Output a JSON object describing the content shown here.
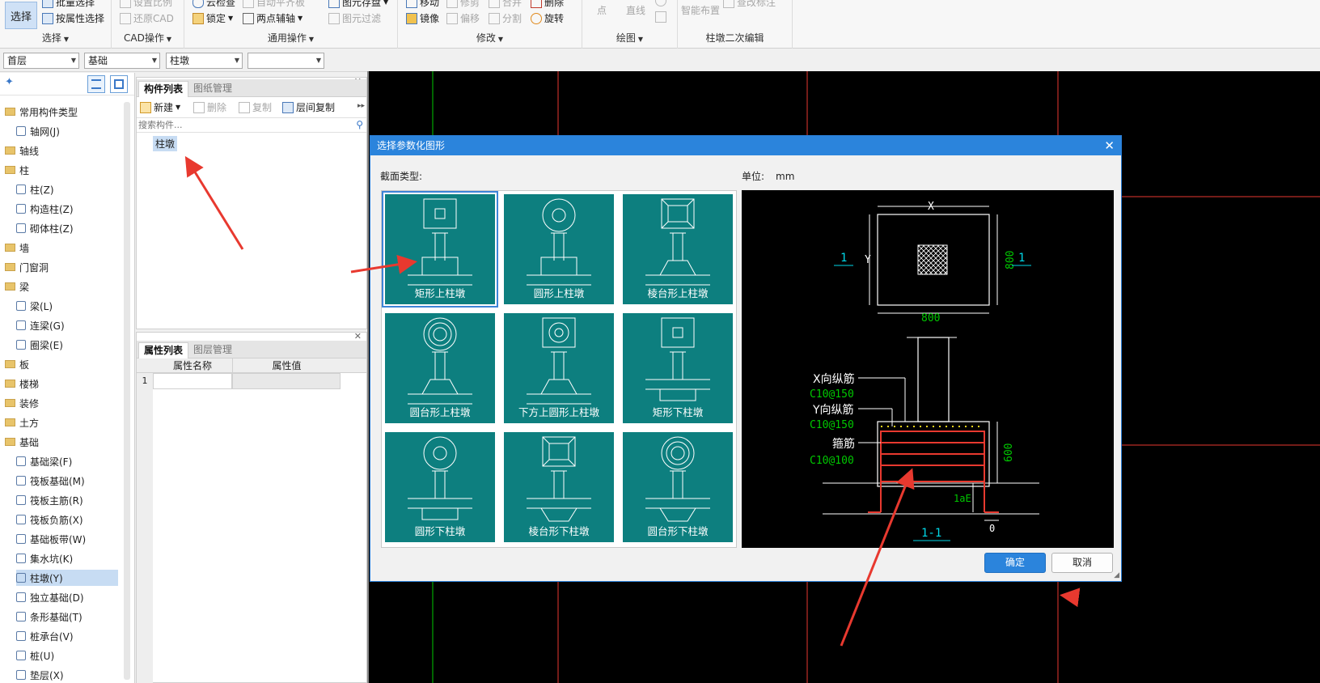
{
  "ribbon": {
    "select_big": "选择",
    "batch_select": "批量选择",
    "prop_select": "按属性选择",
    "group_select": "选择",
    "set_scale": "设置比例",
    "restore_cad": "还原CAD",
    "group_cad": "CAD操作",
    "cloud_check": "云检查",
    "auto_level": "自动平齐板",
    "lock": "锁定",
    "two_point_axis": "两点辅轴",
    "element_save": "图元存盘",
    "element_filter": "图元过滤",
    "group_common": "通用操作",
    "move": "移动",
    "trim": "修剪",
    "merge": "合并",
    "delete": "删除",
    "mirror": "镜像",
    "offset": "偏移",
    "split": "分割",
    "rotate": "旋转",
    "group_modify": "修改",
    "point": "点",
    "line": "直线",
    "group_draw": "绘图",
    "smart_layout": "智能布置",
    "view_annotation": "查改标注",
    "group_pier_edit": "柱墩二次编辑"
  },
  "floorbar": {
    "floor": "首层",
    "category": "基础",
    "type": "柱墩",
    "name": ""
  },
  "tree": {
    "items": [
      {
        "label": "常用构件类型",
        "kind": "folder"
      },
      {
        "label": "轴网(J)",
        "kind": "leaf"
      },
      {
        "label": "轴线",
        "kind": "folder"
      },
      {
        "label": "柱",
        "kind": "folder"
      },
      {
        "label": "柱(Z)",
        "kind": "leaf"
      },
      {
        "label": "构造柱(Z)",
        "kind": "leaf"
      },
      {
        "label": "砌体柱(Z)",
        "kind": "leaf"
      },
      {
        "label": "墙",
        "kind": "folder"
      },
      {
        "label": "门窗洞",
        "kind": "folder"
      },
      {
        "label": "梁",
        "kind": "folder"
      },
      {
        "label": "梁(L)",
        "kind": "leaf"
      },
      {
        "label": "连梁(G)",
        "kind": "leaf"
      },
      {
        "label": "圈梁(E)",
        "kind": "leaf"
      },
      {
        "label": "板",
        "kind": "folder"
      },
      {
        "label": "楼梯",
        "kind": "folder"
      },
      {
        "label": "装修",
        "kind": "folder"
      },
      {
        "label": "土方",
        "kind": "folder"
      },
      {
        "label": "基础",
        "kind": "folder"
      },
      {
        "label": "基础梁(F)",
        "kind": "leaf"
      },
      {
        "label": "筏板基础(M)",
        "kind": "leaf"
      },
      {
        "label": "筏板主筋(R)",
        "kind": "leaf"
      },
      {
        "label": "筏板负筋(X)",
        "kind": "leaf"
      },
      {
        "label": "基础板带(W)",
        "kind": "leaf"
      },
      {
        "label": "集水坑(K)",
        "kind": "leaf"
      },
      {
        "label": "柱墩(Y)",
        "kind": "leaf"
      },
      {
        "label": "独立基础(D)",
        "kind": "leaf"
      },
      {
        "label": "条形基础(T)",
        "kind": "leaf"
      },
      {
        "label": "桩承台(V)",
        "kind": "leaf"
      },
      {
        "label": "桩(U)",
        "kind": "leaf"
      },
      {
        "label": "垫层(X)",
        "kind": "leaf"
      }
    ]
  },
  "component_panel": {
    "tab_list": "构件列表",
    "tab_drawing": "图纸管理",
    "new": "新建",
    "delete": "删除",
    "copy": "复制",
    "floor_copy": "层间复制",
    "search_placeholder": "搜索构件...",
    "item": "柱墩"
  },
  "property_panel": {
    "tab_props": "属性列表",
    "tab_layers": "图层管理",
    "col_name": "属性名称",
    "col_value": "属性值",
    "row1": "1"
  },
  "dialog": {
    "title": "选择参数化图形",
    "section_label": "截面类型:",
    "unit_label": "单位:",
    "unit_value": "mm",
    "ok": "确定",
    "cancel": "取消",
    "shapes": [
      {
        "label": "矩形上柱墩",
        "selected": true
      },
      {
        "label": "圆形上柱墩",
        "selected": false
      },
      {
        "label": "棱台形上柱墩",
        "selected": false
      },
      {
        "label": "圆台形上柱墩",
        "selected": false
      },
      {
        "label": "下方上圆形上柱墩",
        "selected": false
      },
      {
        "label": "矩形下柱墩",
        "selected": false
      },
      {
        "label": "圆形下柱墩",
        "selected": false
      },
      {
        "label": "棱台形下柱墩",
        "selected": false
      },
      {
        "label": "圆台形下柱墩",
        "selected": false
      }
    ],
    "preview": {
      "dim_x": "X",
      "dim_y": "Y",
      "dim_800_right": "800",
      "dim_800_bottom": "800",
      "section_mark": "1",
      "x_rebar": "X向纵筋",
      "x_rebar_spec": "C10@150",
      "y_rebar": "Y向纵筋",
      "y_rebar_spec": "C10@150",
      "stirrup": "箍筋",
      "stirrup_spec": "C10@100",
      "dim_600": "600",
      "dim_lae": "1aE",
      "dim_0": "0",
      "section_title": "1-1"
    }
  },
  "colors": {
    "tile_teal": "#0d7f7f",
    "dialog_blue": "#2b84dc",
    "annotation_red": "#e8392f",
    "cad_green": "#00c800",
    "cad_cyan": "#00d8e8"
  }
}
